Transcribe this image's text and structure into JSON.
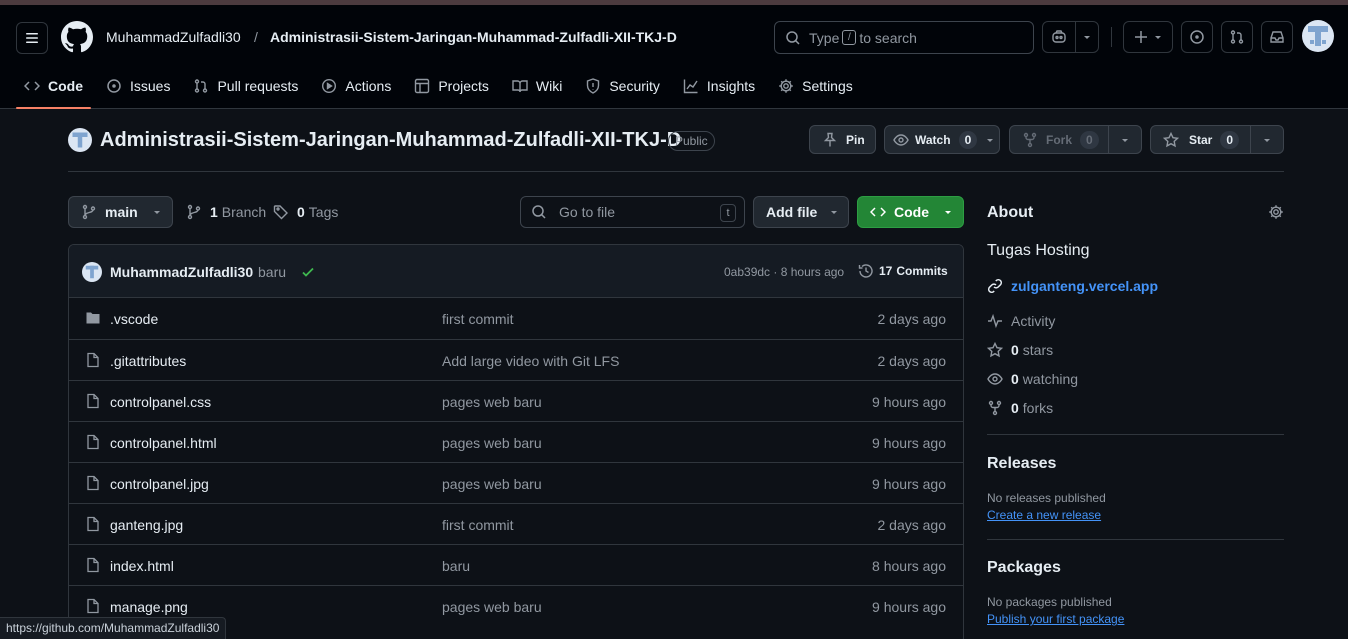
{
  "status_url": "https://github.com/MuhammadZulfadli30",
  "header": {
    "owner": "MuhammadZulfadli30",
    "separator": "/",
    "repo": "Administrasii-Sistem-Jaringan-Muhammad-Zulfadli-XII-TKJ-D",
    "search_prefix": "Type",
    "search_key": "/",
    "search_suffix": "to search"
  },
  "tabs": [
    {
      "label": "Code",
      "icon": "code-icon",
      "active": true
    },
    {
      "label": "Issues",
      "icon": "issue-icon"
    },
    {
      "label": "Pull requests",
      "icon": "pull-request-icon"
    },
    {
      "label": "Actions",
      "icon": "play-icon"
    },
    {
      "label": "Projects",
      "icon": "table-icon"
    },
    {
      "label": "Wiki",
      "icon": "book-icon"
    },
    {
      "label": "Security",
      "icon": "shield-icon"
    },
    {
      "label": "Insights",
      "icon": "graph-icon"
    },
    {
      "label": "Settings",
      "icon": "gear-icon"
    }
  ],
  "repo": {
    "name": "Administrasii-Sistem-Jaringan-Muhammad-Zulfadli-XII-TKJ-D",
    "visibility": "Public",
    "pin_label": "Pin",
    "watch_label": "Watch",
    "watch_count": "0",
    "fork_label": "Fork",
    "fork_count": "0",
    "star_label": "Star",
    "star_count": "0"
  },
  "toolbar": {
    "branch": "main",
    "branch_count": "1",
    "branch_label": "Branch",
    "tag_count": "0",
    "tag_label": "Tags",
    "goto_placeholder": "Go to file",
    "goto_key": "t",
    "add_file_label": "Add file",
    "code_label": "Code"
  },
  "commit": {
    "author": "MuhammadZulfadli30",
    "message": "baru",
    "sha_time": "0ab39dc · 8 hours ago",
    "commits_count": "17",
    "commits_label": "Commits"
  },
  "files": [
    {
      "name": ".vscode",
      "type": "folder",
      "message": "first commit",
      "time": "2 days ago"
    },
    {
      "name": ".gitattributes",
      "type": "file",
      "message": "Add large video with Git LFS",
      "time": "2 days ago"
    },
    {
      "name": "controlpanel.css",
      "type": "file",
      "message": "pages web baru",
      "time": "9 hours ago"
    },
    {
      "name": "controlpanel.html",
      "type": "file",
      "message": "pages web baru",
      "time": "9 hours ago"
    },
    {
      "name": "controlpanel.jpg",
      "type": "file",
      "message": "pages web baru",
      "time": "9 hours ago"
    },
    {
      "name": "ganteng.jpg",
      "type": "file",
      "message": "first commit",
      "time": "2 days ago"
    },
    {
      "name": "index.html",
      "type": "file",
      "message": "baru",
      "time": "8 hours ago"
    },
    {
      "name": "manage.png",
      "type": "file",
      "message": "pages web baru",
      "time": "9 hours ago"
    }
  ],
  "about": {
    "title": "About",
    "description": "Tugas Hosting",
    "link": "zulganteng.vercel.app",
    "activity": "Activity",
    "stars_count": "0",
    "stars_label": "stars",
    "watching_count": "0",
    "watching_label": "watching",
    "forks_count": "0",
    "forks_label": "forks"
  },
  "releases": {
    "title": "Releases",
    "empty": "No releases published",
    "create_link": "Create a new release"
  },
  "packages": {
    "title": "Packages",
    "empty": "No packages published",
    "publish_link": "Publish your first package"
  },
  "colors": {
    "accent_link": "#4493f8",
    "primary_button": "#238636",
    "tab_underline": "#f78166",
    "success": "#3fb950"
  }
}
